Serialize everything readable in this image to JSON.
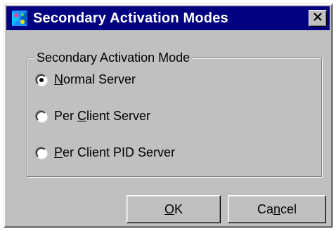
{
  "window": {
    "title": "Secondary Activation Modes",
    "close_label": "×"
  },
  "group": {
    "legend": "Secondary Activation Mode",
    "selected": "Normal Server",
    "options": [
      {
        "label": "Normal Server",
        "pre": "",
        "mnemonic": "N",
        "post": "ormal Server",
        "selected": true
      },
      {
        "label": "Per Client Server",
        "pre": "Per ",
        "mnemonic": "C",
        "post": "lient Server",
        "selected": false
      },
      {
        "label": "Per Client PID Server",
        "pre": "",
        "mnemonic": "P",
        "post": "er Client PID Server",
        "selected": false
      }
    ]
  },
  "buttons": {
    "ok": {
      "pre": "",
      "mnemonic": "O",
      "post": "K"
    },
    "cancel": {
      "pre": "Ca",
      "mnemonic": "n",
      "post": "cel"
    }
  },
  "icons": {
    "app": "app-window-icon",
    "close": "close-icon"
  },
  "colors": {
    "titlebar": "#000080",
    "face": "#c0c0c0"
  }
}
